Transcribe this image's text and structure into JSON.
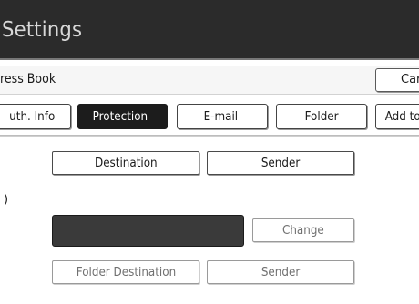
{
  "window": {
    "title": "Settings"
  },
  "header": {
    "section_label": "ress Book",
    "cancel_label": "Car"
  },
  "tabs": [
    {
      "label": "uth. Info",
      "selected": false
    },
    {
      "label": "Protection",
      "selected": true
    },
    {
      "label": "E-mail",
      "selected": false
    },
    {
      "label": "Folder",
      "selected": false
    },
    {
      "label": "Add to",
      "selected": false
    }
  ],
  "content": {
    "destination_label": "Destination",
    "sender_label": "Sender",
    "stray_mark": ")",
    "change_label": "Change",
    "folder_destination_label": "Folder Destination",
    "sender_label_2": "Sender"
  }
}
